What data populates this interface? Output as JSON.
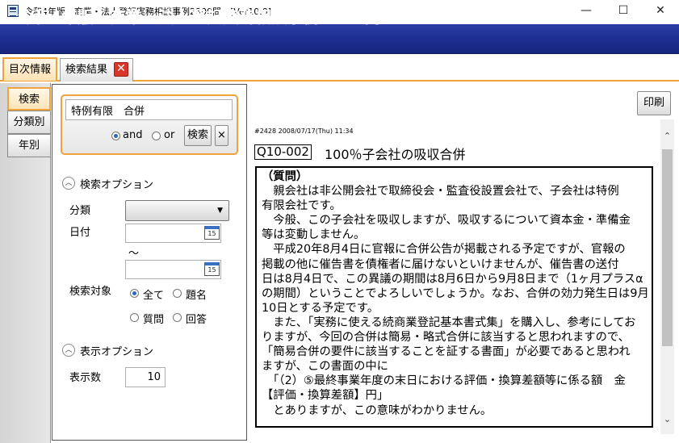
{
  "window": {
    "title": "令和4年版　商業・法人登記実務相談事例2800問　[Ver10.0]",
    "minimize": "—",
    "maximize": "☐",
    "close": "✕"
  },
  "banner": {
    "title": "令和4年版　商業・法人登記実務相談事例2800問"
  },
  "tabs": [
    {
      "label": "目次情報"
    },
    {
      "label": "検索結果"
    }
  ],
  "tab_close_glyph": "✕",
  "rail": {
    "items": [
      "検索",
      "分類別",
      "年別"
    ]
  },
  "search": {
    "query": "特例有限　合併",
    "mode_and": "and",
    "mode_or": "or",
    "selected_mode": "and",
    "search_button": "検索",
    "clear_button": "×"
  },
  "options": {
    "search_options_heading": "検索オプション",
    "category_label": "分類",
    "category_value": "",
    "date_label": "日付",
    "date_from": "",
    "date_tilde": "～",
    "date_to": "",
    "calendar_day": "15",
    "target_label": "検索対象",
    "target_options": [
      "全て",
      "題名",
      "質問",
      "回答"
    ],
    "target_selected": "全て",
    "display_options_heading": "表示オプション",
    "count_label": "表示数",
    "count_value": "10"
  },
  "content": {
    "print_button": "印刷",
    "meta": "#2428 2008/07/17(Thu) 11:34",
    "question_id": "Q10-002",
    "question_title": "100％子会社の吸収合併",
    "heading": "（質問）",
    "lines": [
      "　親会社は非公開会社で取締役会・監査役設置会社で、子会社は特例",
      "有限会社です。",
      "　今般、この子会社を吸収しますが、吸収するについて資本金・準備金",
      "等は変動しません。",
      "　平成20年8月4日に官報に合併公告が掲載される予定ですが、官報の",
      "掲載の他に催告書を債権者に届けないといけませんが、催告書の送付",
      "日は8月4日で、この異議の期間は8月6日から9月8日まで（1ヶ月プラスα",
      "の期間）ということでよろしいでしょうか。なお、合併の効力発生日は9月",
      "10日とする予定です。",
      "　また、「実務に使える続商業登記基本書式集」を購入し、参考にしてお",
      "りますが、今回の合併は簡易・略式合併に該当すると思われますので、",
      "「簡易合併の要件に該当することを証する書面」が必要であると思われ",
      "ますが、この書面の中に",
      "　「（2）⑤最終事業年度の末日における評価・換算差額等に係る額　金",
      "【評価・換算差額】円」",
      "　とありますが、この意味がわかりません。"
    ]
  },
  "scrollbar": {
    "up": "⌃",
    "down": "⌄"
  }
}
